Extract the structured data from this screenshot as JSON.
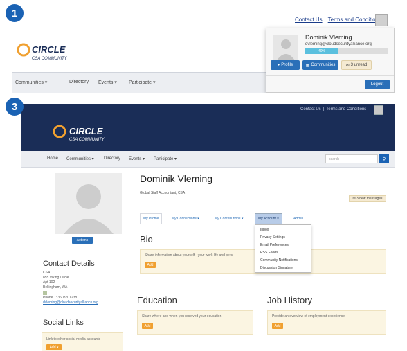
{
  "steps": {
    "first": "1",
    "second": "3"
  },
  "panel1": {
    "top_links": {
      "contact": "Contact Us",
      "terms": "Terms and Conditions"
    },
    "logo": {
      "title": "CIRCLE",
      "subtitle": "CSA COMMUNITY"
    },
    "nav": [
      "Communities ▾",
      "Directory",
      "Events ▾",
      "Participate ▾"
    ],
    "dropdown": {
      "name": "Dominik Vleming",
      "email": "dvleming@cloudsecurityalliance.org",
      "progress_label": "40%",
      "progress_value": 0.4,
      "profile_btn": "Profile",
      "communities_btn": "Communities",
      "unread_btn": "3 unread",
      "logout_btn": "Logout"
    }
  },
  "panel3": {
    "top_links": {
      "contact": "Contact Us",
      "terms": "Terms and Conditions"
    },
    "logo": {
      "title": "CIRCLE",
      "subtitle": "CSA COMMUNITY"
    },
    "nav": [
      "Home",
      "Communities ▾",
      "Directory",
      "Events ▾",
      "Participate ▾"
    ],
    "search_placeholder": "search",
    "actions_btn": "Actions",
    "name": "Dominik Vleming",
    "job": "Global Staff Accountant, CSA",
    "messages": "3 new messages",
    "tabs": [
      "My Profile",
      "My Connections ▾",
      "My Contributions ▾",
      "My Account ▾",
      "Admin"
    ],
    "account_menu": [
      "Inbox",
      "Privacy Settings",
      "Email Preferences",
      "RSS Feeds",
      "Community Notifications",
      "Discussion Signature"
    ],
    "bio": {
      "title": "Bio",
      "text": "Share information about yourself - your work life and pers",
      "add": "Add"
    },
    "contact": {
      "title": "Contact Details",
      "lines": [
        "CSA",
        "855 Viking Circle",
        "Apt 102",
        "Bellingham, WA"
      ],
      "phone": "Phone 1: 3608701238",
      "email": "dvleming@cloudsecurityalliance.org"
    },
    "social": {
      "title": "Social Links",
      "text": "Link to other social media accounts",
      "add": "Add ▾"
    },
    "education": {
      "title": "Education",
      "text": "Share where and when you received your education",
      "add": "Add"
    },
    "job_history": {
      "title": "Job History",
      "text": "Provide an overview of employment experience",
      "add": "Add"
    }
  },
  "colors": {
    "navy": "#1a2d57",
    "blue": "#2a6fb8",
    "orange": "#f0a030",
    "badge": "#1a62b4"
  }
}
